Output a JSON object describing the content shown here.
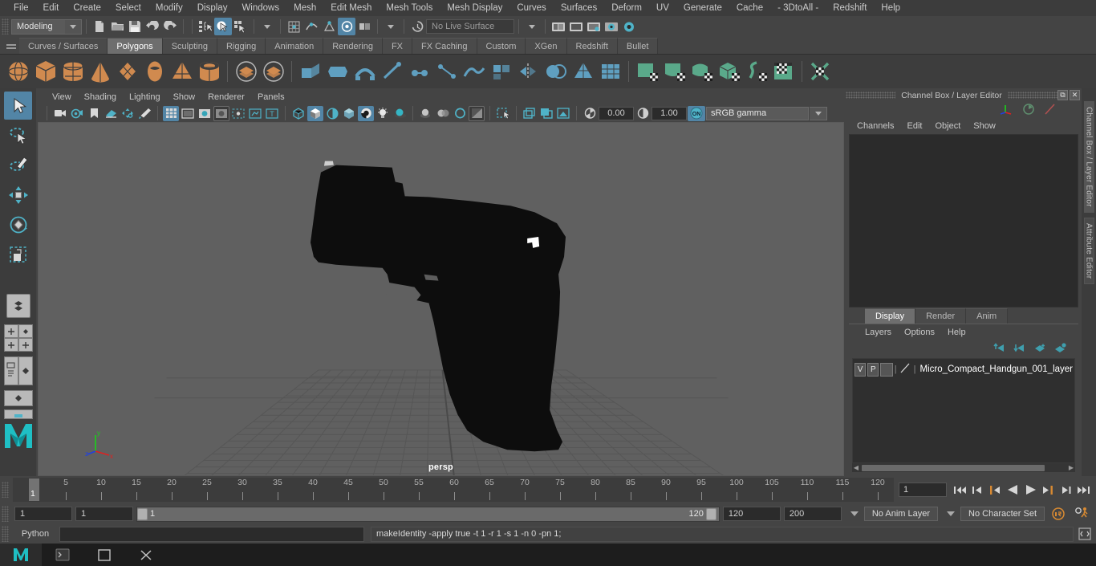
{
  "menubar": {
    "items": [
      "File",
      "Edit",
      "Create",
      "Select",
      "Modify",
      "Display",
      "Windows",
      "Mesh",
      "Edit Mesh",
      "Mesh Tools",
      "Mesh Display",
      "Curves",
      "Surfaces",
      "Deform",
      "UV",
      "Generate",
      "Cache",
      "- 3DtoAll -",
      "Redshift",
      "Help"
    ]
  },
  "statusline": {
    "mode": "Modeling",
    "live_surface": "No Live Surface",
    "icons": [
      "new-scene-icon",
      "open-scene-icon",
      "save-scene-icon",
      "undo-icon",
      "redo-icon",
      "select-hierarchy-icon",
      "select-object-icon",
      "select-component-icon",
      "snap-grid-icon",
      "snap-curve-icon",
      "snap-point-icon",
      "snap-view-icon",
      "snap-projected-icon",
      "construction-history-icon",
      "render-view-icon",
      "render-current-frame-icon",
      "ipr-render-icon",
      "render-settings-icon",
      "hypershade-icon",
      "outliner-icon",
      "node-editor-icon",
      "attribute-editor-icon",
      "tool-settings-icon"
    ]
  },
  "shelf": {
    "tabs": [
      "Curves / Surfaces",
      "Polygons",
      "Sculpting",
      "Rigging",
      "Animation",
      "Rendering",
      "FX",
      "FX Caching",
      "Custom",
      "XGen",
      "Redshift",
      "Bullet"
    ],
    "active_tab": "Polygons",
    "icons": [
      {
        "name": "poly-sphere-icon",
        "color": "#d08a4f",
        "shape": "sphere"
      },
      {
        "name": "poly-cube-icon",
        "color": "#d08a4f",
        "shape": "cube"
      },
      {
        "name": "poly-cylinder-icon",
        "color": "#d08a4f",
        "shape": "cylinder"
      },
      {
        "name": "poly-cone-icon",
        "color": "#d08a4f",
        "shape": "cone"
      },
      {
        "name": "poly-plane-icon",
        "color": "#d08a4f",
        "shape": "plane"
      },
      {
        "name": "poly-torus-icon",
        "color": "#d08a4f",
        "shape": "torus"
      },
      {
        "name": "poly-pyramid-icon",
        "color": "#d08a4f",
        "shape": "pyramid"
      },
      {
        "name": "poly-pipe-icon",
        "color": "#d08a4f",
        "shape": "pipe"
      },
      {
        "name": "combine-icon",
        "color": "#d08a4f",
        "shape": "stack"
      },
      {
        "name": "separate-icon",
        "color": "#d08a4f",
        "shape": "stack"
      },
      {
        "name": "extrude-icon",
        "color": "#5f9fc0",
        "shape": "extrude"
      },
      {
        "name": "bevel-icon",
        "color": "#5f9fc0",
        "shape": "bevel"
      },
      {
        "name": "bridge-icon",
        "color": "#5f9fc0",
        "shape": "bridge"
      },
      {
        "name": "multi-cut-icon",
        "color": "#5f9fc0",
        "shape": "cut"
      },
      {
        "name": "target-weld-icon",
        "color": "#5f9fc0",
        "shape": "weld"
      },
      {
        "name": "connect-icon",
        "color": "#5f9fc0",
        "shape": "connect"
      },
      {
        "name": "smooth-icon",
        "color": "#5f9fc0",
        "shape": "smooth"
      },
      {
        "name": "quad-draw-icon",
        "color": "#5f9fc0",
        "shape": "quad"
      },
      {
        "name": "mirror-icon",
        "color": "#5f9fc0",
        "shape": "mirror"
      },
      {
        "name": "boolean-icon",
        "color": "#5f9fc0",
        "shape": "bool"
      },
      {
        "name": "reduce-icon",
        "color": "#5f9fc0",
        "shape": "reduce"
      },
      {
        "name": "remesh-icon",
        "color": "#5f9fc0",
        "shape": "remesh"
      },
      {
        "name": "uv-planar-icon",
        "color": "#5aa98a",
        "shape": "uvplane"
      },
      {
        "name": "uv-cylindrical-icon",
        "color": "#5aa98a",
        "shape": "uvcyl"
      },
      {
        "name": "uv-spherical-icon",
        "color": "#5aa98a",
        "shape": "uvsph"
      },
      {
        "name": "uv-automatic-icon",
        "color": "#5aa98a",
        "shape": "uvauto"
      },
      {
        "name": "uv-unfold-icon",
        "color": "#5aa98a",
        "shape": "uvunfold"
      },
      {
        "name": "uv-editor-icon",
        "color": "#5aa98a",
        "shape": "uveditor"
      },
      {
        "name": "uv-cut-sew-icon",
        "color": "#5aa98a",
        "shape": "uvcut"
      }
    ]
  },
  "toolbox": {
    "items": [
      {
        "name": "select-tool",
        "label": "Select Tool",
        "selected": true
      },
      {
        "name": "lasso-select-tool",
        "label": "Lasso Select Tool",
        "selected": false
      },
      {
        "name": "paint-select-tool",
        "label": "Paint Select Tool",
        "selected": false
      },
      {
        "name": "move-tool",
        "label": "Move Tool",
        "selected": false
      },
      {
        "name": "rotate-tool",
        "label": "Rotate Tool",
        "selected": false
      },
      {
        "name": "scale-tool",
        "label": "Scale Tool",
        "selected": false
      },
      {
        "name": "last-tool",
        "label": "Last Tool Used",
        "selected": false
      }
    ],
    "layouts": [
      "single-perspective-layout",
      "four-view-layout",
      "persp-outliner-layout",
      "persp-graph-layout",
      "hypershade-layout"
    ]
  },
  "viewport": {
    "menu": [
      "View",
      "Shading",
      "Lighting",
      "Show",
      "Renderer",
      "Panels"
    ],
    "exposure": "0.00",
    "gamma": "1.00",
    "color_management": "sRGB gamma",
    "camera_label": "persp",
    "background_color": "#606060",
    "grid_color": "#555555",
    "object_color": "#0c0c0c",
    "axis_labels": {
      "x": "x",
      "y": "y",
      "z": "z"
    },
    "toolbar_icons": [
      "select-camera-icon",
      "bookmark-icon",
      "image-plane-icon",
      "2d-pan-zoom-icon",
      "grease-pencil-icon",
      "grid-toggle-icon",
      "film-gate-icon",
      "resolution-gate-icon",
      "gate-mask-icon",
      "film-origin-icon",
      "safe-action-icon",
      "title-safe-icon",
      "wireframe-icon",
      "smooth-shade-icon",
      "shaded-wireframe-icon",
      "textured-icon",
      "checker-icon",
      "lights-icon",
      "shadows-icon",
      "screen-space-ao-icon",
      "motion-blur-icon",
      "multisample-icon",
      "depth-of-field-icon",
      "xray-icon",
      "isolate-select-icon",
      "exposure-icon",
      "gamma-icon",
      "color-management-icon"
    ]
  },
  "channelbox": {
    "title": "Channel Box / Layer Editor",
    "menu": [
      "Channels",
      "Edit",
      "Object",
      "Show"
    ],
    "header_icons": [
      "channel-box-icon",
      "anim-layer-icon",
      "attribute-editor-icon"
    ],
    "window_buttons": [
      "restore-icon",
      "close-icon"
    ]
  },
  "layereditor": {
    "tabs": [
      "Display",
      "Render",
      "Anim"
    ],
    "active_tab": "Display",
    "menu": [
      "Layers",
      "Options",
      "Help"
    ],
    "buttons": [
      "move-layer-up-icon",
      "move-layer-down-icon",
      "new-layer-icon",
      "new-layer-from-selection-icon"
    ],
    "layers": [
      {
        "visibility": "V",
        "playback": "P",
        "color_swatch": "",
        "name": "Micro_Compact_Handgun_001_layer"
      }
    ]
  },
  "vertical_tabs": [
    "Channel Box / Layer Editor",
    "Attribute Editor"
  ],
  "timeline": {
    "ticks": [
      5,
      10,
      15,
      20,
      25,
      30,
      35,
      40,
      45,
      50,
      55,
      60,
      65,
      70,
      75,
      80,
      85,
      90,
      95,
      100,
      105,
      110,
      115,
      120
    ],
    "current_frame": "1",
    "frame_field": "1",
    "playback_buttons": [
      "go-to-start-icon",
      "step-back-keyframe-icon",
      "step-back-frame-icon",
      "play-backwards-icon",
      "play-forwards-icon",
      "step-forward-frame-icon",
      "step-forward-keyframe-icon",
      "go-to-end-icon"
    ]
  },
  "rangeslider": {
    "anim_start": "1",
    "playback_start": "1",
    "range_lo": "1",
    "range_hi": "120",
    "playback_end": "120",
    "anim_end": "200",
    "anim_layer": "No Anim Layer",
    "character_set": "No Character Set",
    "icons": [
      "auto-keyframe-icon",
      "animation-preferences-icon"
    ]
  },
  "commandline": {
    "language": "Python",
    "input_value": "",
    "output": "makeIdentity -apply true -t 1 -r 1 -s 1 -n 0 -pn 1;",
    "script_editor_icon": "script-editor-icon"
  },
  "taskbar": {
    "items": [
      "maya-app-icon",
      "terminal-icon",
      "window-icon",
      "close-icon"
    ]
  }
}
